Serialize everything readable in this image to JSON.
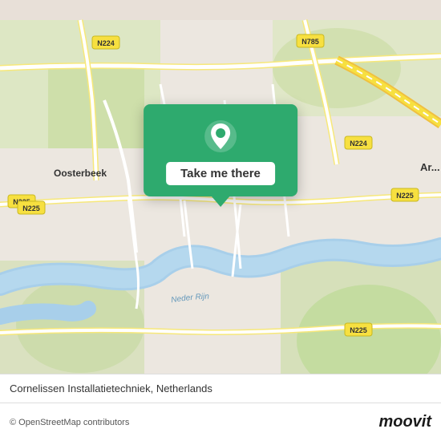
{
  "map": {
    "attribution": "© OpenStreetMap contributors",
    "location_name": "Cornelissen Installatietechniek, Netherlands",
    "popup_button_label": "Take me there",
    "brand": "moovit"
  },
  "colors": {
    "popup_bg": "#2eaa6e",
    "map_bg": "#e8e0d8",
    "road_main": "#ffffff",
    "road_secondary": "#f5e9a0",
    "water": "#a8d0e8",
    "green": "#c8dca0",
    "highway": "#f5c842"
  }
}
